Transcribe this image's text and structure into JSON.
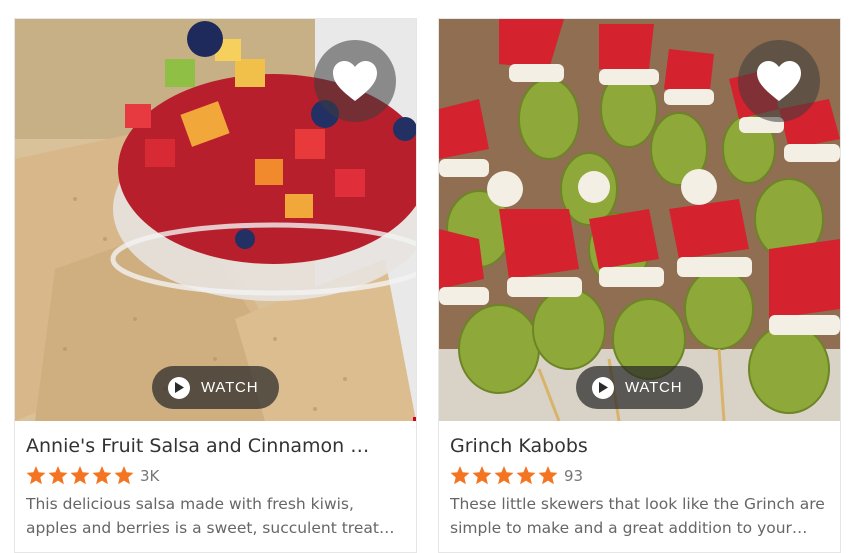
{
  "cards": [
    {
      "title": "Annie's Fruit Salsa and Cinnamon Chips",
      "title_display": "Annie's Fruit Salsa and Cinnamon …",
      "rating_stars": 5,
      "review_count": "3K",
      "watch_label": "WATCH",
      "description_line1": "This delicious salsa made with fresh kiwis,",
      "description_line2": "apples and berries is a sweet, succulent treat…"
    },
    {
      "title": "Grinch Kabobs",
      "title_display": "Grinch Kabobs",
      "rating_stars": 5,
      "review_count": "93",
      "watch_label": "WATCH",
      "description_line1": "These little skewers that look like the Grinch are",
      "description_line2": "simple to make and a great addition to your…"
    }
  ],
  "colors": {
    "star": "#f47521",
    "title_text": "#333333",
    "description_text": "#666666"
  },
  "icons": [
    "heart-icon",
    "play-icon",
    "star-icon"
  ]
}
